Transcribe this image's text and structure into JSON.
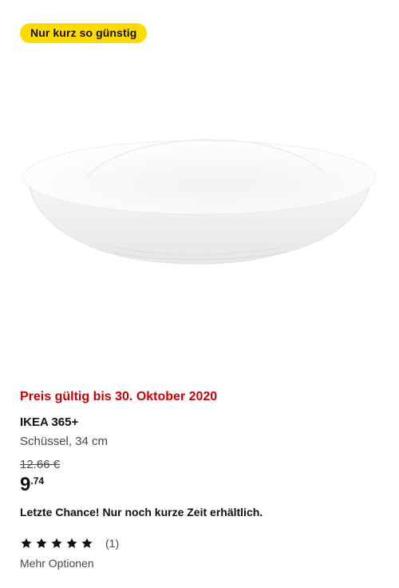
{
  "badge": {
    "label": "Nur kurz so günstig",
    "color": "#ffdb00"
  },
  "image": {
    "icon": "bowl-product-image"
  },
  "offer": {
    "validity": "Preis gültig bis 30. Oktober 2020",
    "color": "#cc0008"
  },
  "product": {
    "name": "IKEA 365+",
    "description": "Schüssel, 34 cm"
  },
  "price": {
    "old": "12.66 €",
    "integer": "9",
    "decimal": ".74"
  },
  "notice": "Letzte Chance! Nur noch kurze Zeit erhältlich.",
  "rating": {
    "stars": 5,
    "max_stars": 5,
    "count": "(1)"
  },
  "more_options": "Mehr Optionen"
}
